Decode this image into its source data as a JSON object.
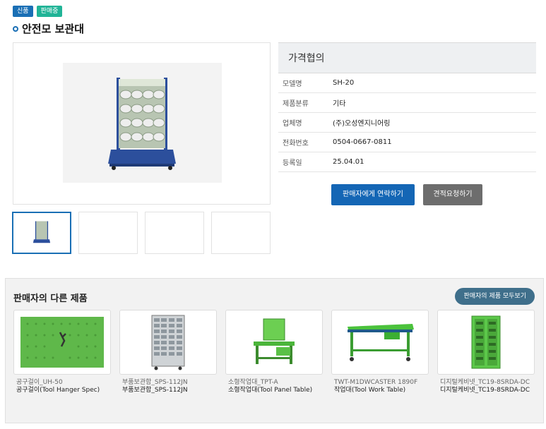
{
  "badges": {
    "new": "신품",
    "sale": "판매중"
  },
  "product": {
    "title": "안전모 보관대",
    "price": "가격협의",
    "specs": [
      {
        "key": "모델명",
        "value": "SH-20"
      },
      {
        "key": "제품분류",
        "value": "기타"
      },
      {
        "key": "업체명",
        "value": "(주)오성엔지니어링"
      },
      {
        "key": "전화번호",
        "value": "0504-0667-0811"
      },
      {
        "key": "등록일",
        "value": "25.04.01"
      }
    ]
  },
  "buttons": {
    "contact": "판매자에게 연락하기",
    "quote": "견적요청하기"
  },
  "other": {
    "title": "판매자의 다른 제품",
    "view_all": "판매자의 제품 모두보기",
    "items": [
      {
        "code": "공구걸이_UH-50",
        "name": "공구걸이(Tool Hanger Spec)",
        "icon": "tool-hanger-icon"
      },
      {
        "code": "부품보관함_SPS-112JN",
        "name": "부품보관함_SPS-112JN",
        "icon": "parts-cabinet-icon"
      },
      {
        "code": "소형작업대_TPT-A",
        "name": "소형작업대(Tool Panel Table)",
        "icon": "tool-panel-table-icon"
      },
      {
        "code": "TWT-M1DWCASTER 1890F",
        "name": "작업대(Tool Work Table)",
        "icon": "work-table-icon"
      },
      {
        "code": "디지털케비넷_TC19-8SRDA-DC",
        "name": "디지털케비넷_TC19-8SRDA-DC",
        "icon": "digital-cabinet-icon"
      }
    ]
  },
  "colors": {
    "accent": "#1a6fb5",
    "badge_sale": "#21b497",
    "quote_btn": "#6d6d6d",
    "view_all": "#3f6f8b"
  }
}
